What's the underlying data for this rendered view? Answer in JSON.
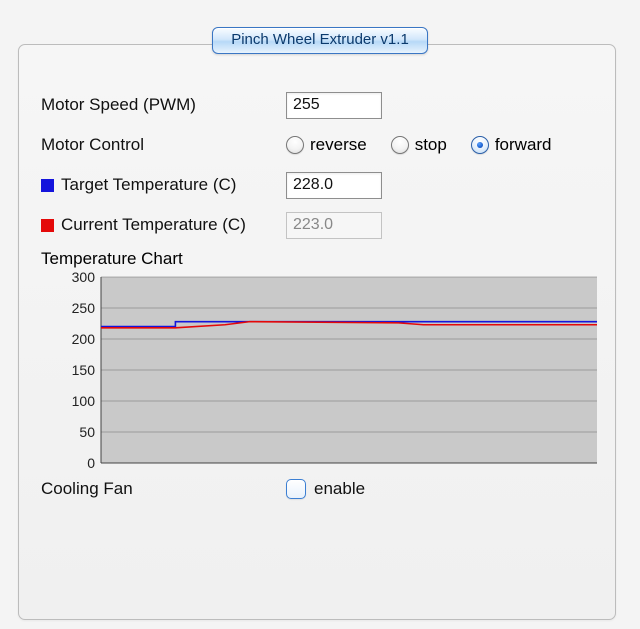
{
  "tab_title": "Pinch Wheel Extruder v1.1",
  "motor_speed": {
    "label": "Motor Speed (PWM)",
    "value": "255"
  },
  "motor_control": {
    "label": "Motor Control",
    "options": {
      "reverse": "reverse",
      "stop": "stop",
      "forward": "forward"
    },
    "selected": "forward"
  },
  "target_temp": {
    "label": "Target Temperature (C)",
    "value": "228.0",
    "color": "#1414dc"
  },
  "current_temp": {
    "label": "Current Temperature (C)",
    "value": "223.0",
    "color": "#e40909"
  },
  "chart_title": "Temperature Chart",
  "cooling_fan": {
    "label": "Cooling Fan",
    "option": "enable",
    "checked": false
  },
  "chart_data": {
    "type": "line",
    "title": "Temperature Chart",
    "xlabel": "",
    "ylabel": "",
    "ylim": [
      0,
      300
    ],
    "yticks": [
      0,
      50,
      100,
      150,
      200,
      250,
      300
    ],
    "x_range": [
      0,
      100
    ],
    "series": [
      {
        "name": "Target Temperature (C)",
        "color": "#1414dc",
        "x": [
          0,
          15,
          15,
          100
        ],
        "values": [
          220,
          220,
          228,
          228
        ]
      },
      {
        "name": "Current Temperature (C)",
        "color": "#e40909",
        "x": [
          0,
          15,
          25,
          30,
          60,
          65,
          100
        ],
        "values": [
          218,
          218,
          223,
          228,
          226,
          223,
          223
        ]
      }
    ]
  }
}
